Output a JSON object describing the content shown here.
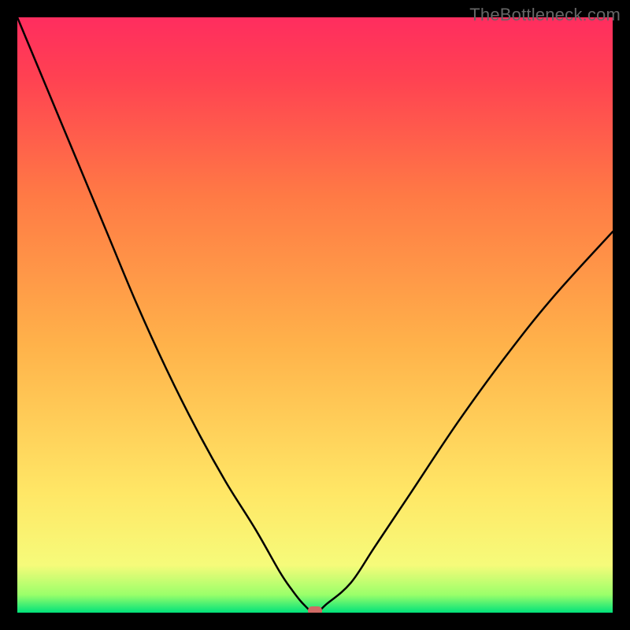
{
  "watermark": "TheBottleneck.com",
  "chart_data": {
    "type": "line",
    "title": "",
    "xlabel": "",
    "ylabel": "",
    "xlim": [
      0,
      100
    ],
    "ylim": [
      0,
      100
    ],
    "grid": false,
    "x": [
      0,
      5,
      10,
      15,
      20,
      25,
      30,
      35,
      40,
      44,
      46,
      48,
      50,
      52,
      56,
      60,
      66,
      74,
      82,
      90,
      100
    ],
    "y": [
      100,
      88,
      76,
      64,
      52,
      41,
      31,
      22,
      14,
      7,
      4,
      1.5,
      0,
      1.5,
      5,
      11,
      20,
      32,
      43,
      53,
      64
    ],
    "marker": {
      "x": 50,
      "y": 0,
      "color": "#cf6a65"
    },
    "background_gradient": {
      "stops": [
        {
          "pos": 0.0,
          "color": "#00e27a"
        },
        {
          "pos": 0.03,
          "color": "#9aff6a"
        },
        {
          "pos": 0.08,
          "color": "#f6fb7a"
        },
        {
          "pos": 0.2,
          "color": "#ffe766"
        },
        {
          "pos": 0.45,
          "color": "#ffb24a"
        },
        {
          "pos": 0.7,
          "color": "#ff7a45"
        },
        {
          "pos": 0.9,
          "color": "#ff4152"
        },
        {
          "pos": 1.0,
          "color": "#ff2d5f"
        }
      ]
    }
  }
}
